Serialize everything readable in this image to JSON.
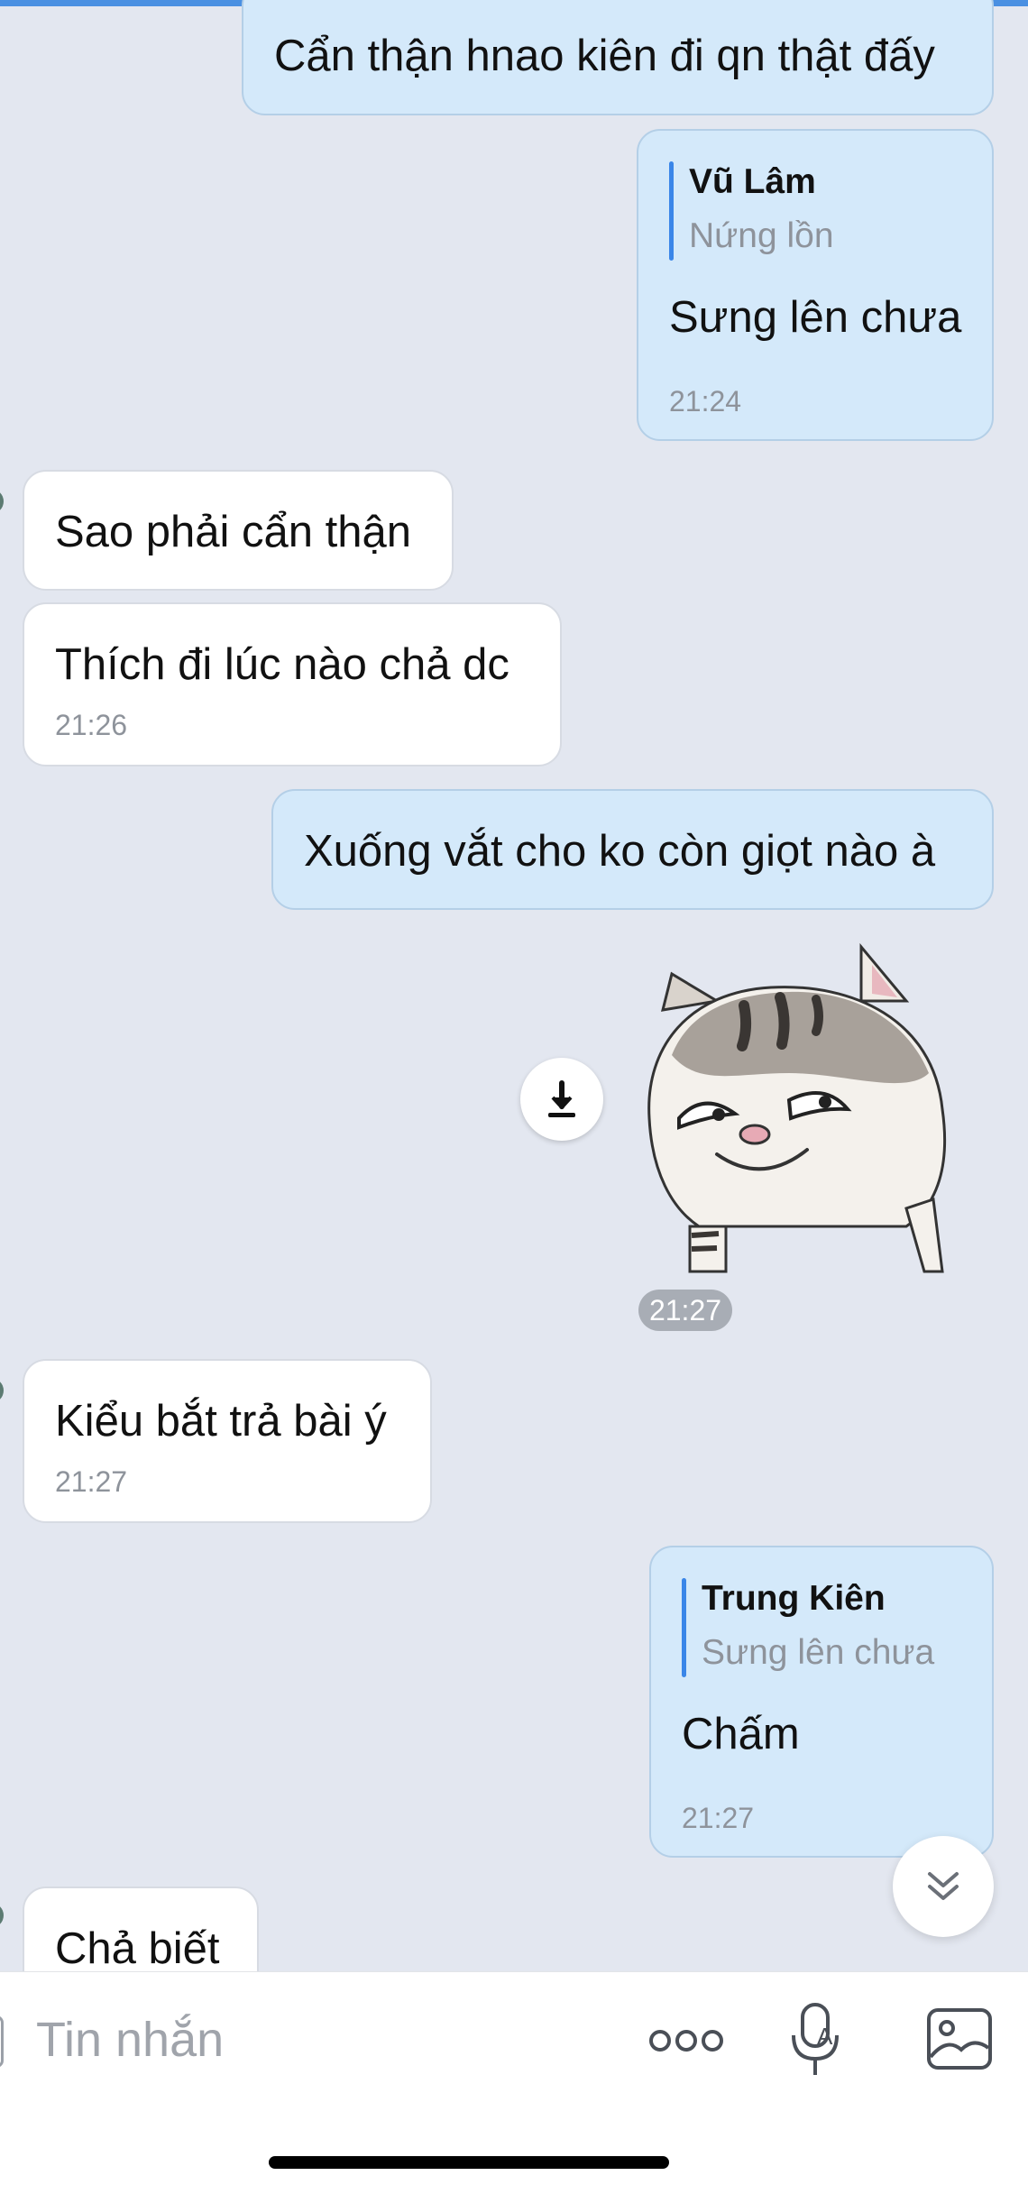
{
  "messages": [
    {
      "direction": "out",
      "text": "Cẩn thận hnao kiên đi qn thật đấy"
    },
    {
      "direction": "out",
      "reply": {
        "name": "Vũ Lâm",
        "text": "Nứng lồn"
      },
      "text": "Sưng lên chưa",
      "time": "21:24"
    },
    {
      "direction": "in",
      "text": "Sao phải cẩn thận"
    },
    {
      "direction": "in",
      "text": "Thích đi lúc nào chả dc",
      "time": "21:26"
    },
    {
      "direction": "out",
      "text": "Xuống vắt cho ko còn giọt nào à"
    },
    {
      "direction": "out",
      "type": "sticker",
      "sticker": "smirking-cat-sticker",
      "time": "21:27"
    },
    {
      "direction": "in",
      "text": "Kiểu bắt trả bài ý",
      "time": "21:27"
    },
    {
      "direction": "out",
      "reply": {
        "name": "Trung Kiên",
        "text": "Sưng lên chưa"
      },
      "text": "Chấm",
      "time": "21:27"
    },
    {
      "direction": "in",
      "text": "Chả biết"
    }
  ],
  "composer": {
    "placeholder": "Tin nhắn",
    "icons": [
      "more-icon",
      "voice-to-text-icon",
      "image-icon"
    ]
  },
  "colors": {
    "background": "#e3e7f0",
    "outgoing_bubble": "#d4e9fa",
    "incoming_bubble": "#ffffff",
    "reply_accent": "#3a86e8",
    "top_bar": "#4a90e2"
  }
}
